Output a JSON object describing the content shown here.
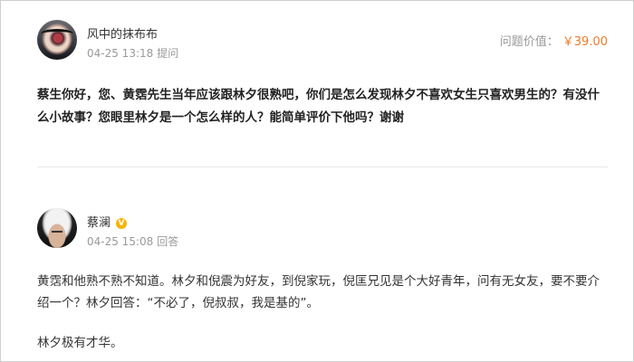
{
  "question": {
    "author_name": "风中的抹布布",
    "date": "04-25 13:18",
    "action": "提问",
    "value_label": "问题价值：",
    "value_amount": "￥39.00",
    "text": "蔡生你好，您、黄霑先生当年应该跟林夕很熟吧，你们是怎么发现林夕不喜欢女生只喜欢男生的？有没什么小故事？您眼里林夕是一个怎么样的人？能简单评价下他吗？谢谢"
  },
  "answer": {
    "author_name": "蔡澜",
    "verified_icon": "verified-badge-icon",
    "date": "04-25 15:08",
    "action": "回答",
    "paragraphs": [
      "黄霑和他熟不熟不知道。林夕和倪震为好友，到倪家玩，倪匡兄见是个大好青年，问有无女友，要不要介绍一个？林夕回答：“不必了，倪叔叔，我是基的”。",
      "林夕极有才华。"
    ]
  },
  "colors": {
    "price": "#f07a2a",
    "meta": "#999999",
    "verified": "#f5b400"
  }
}
